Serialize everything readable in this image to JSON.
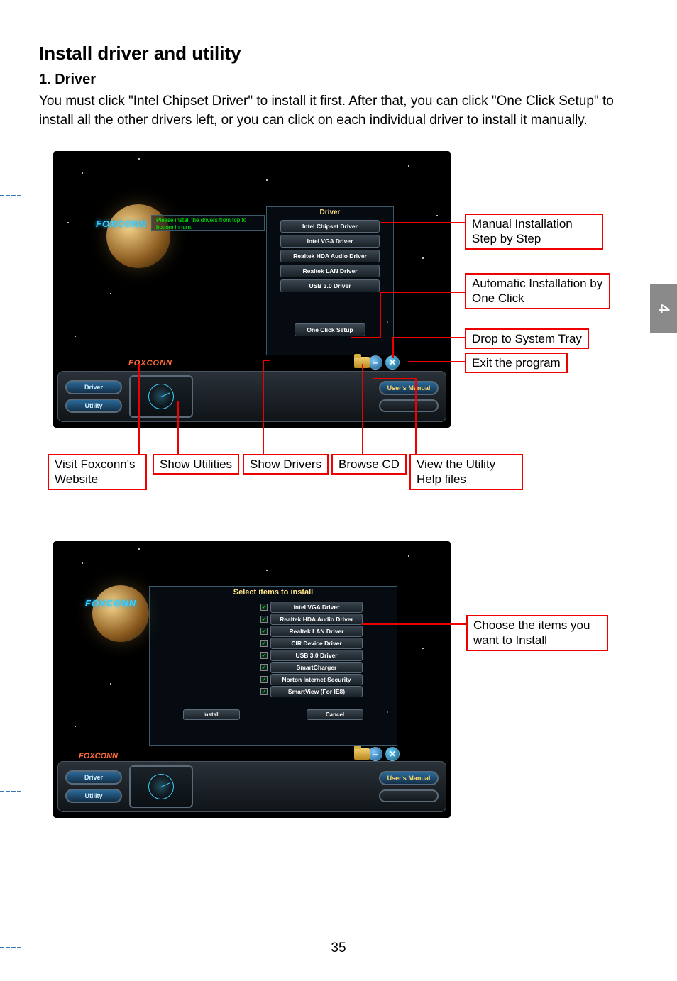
{
  "page": {
    "title": "Install driver and utility",
    "section_title": "1. Driver",
    "body": "You must click \"Intel Chipset Driver\" to install it first. After that, you can click \"One Click Setup\" to install all the other drivers left, or you can click on each individual driver to install it manually.",
    "page_number": "35",
    "side_tab": "4"
  },
  "screenshot1": {
    "brand_small": "FOXCONN",
    "panel_header": "Driver",
    "hint": "Please install the drivers from top to bottom in turn.",
    "drivers": [
      "Intel Chipset Driver",
      "Intel VGA Driver",
      "Realtek HDA Audio Driver",
      "Realtek LAN Driver",
      "USB 3.0 Driver"
    ],
    "one_click": "One Click Setup",
    "bottom": {
      "brand": "FOXCONN",
      "btn_driver": "Driver",
      "btn_utility": "Utility",
      "btn_manual": "User's Manual"
    },
    "callouts": {
      "manual": "Manual Installation Step by Step",
      "auto": "Automatic Installation by One Click",
      "tray": "Drop to System Tray",
      "exit": "Exit the program",
      "website": "Visit Foxconn's Website",
      "utilities": "Show Utilities",
      "drivers": "Show Drivers",
      "browse": "Browse CD",
      "help": "View the Utility Help files"
    }
  },
  "screenshot2": {
    "brand_small": "FOXCONN",
    "header": "Select items to install",
    "items": [
      "Intel VGA Driver",
      "Realtek HDA Audio Driver",
      "Realtek LAN Driver",
      "CIR Device Driver",
      "USB 3.0 Driver",
      "SmartCharger",
      "Norton Internet Security",
      "SmartView (For IE8)"
    ],
    "install": "Install",
    "cancel": "Cancel",
    "bottom": {
      "brand": "FOXCONN",
      "btn_driver": "Driver",
      "btn_utility": "Utility",
      "btn_manual": "User's Manual"
    },
    "callout": "Choose the items you want to Install"
  }
}
